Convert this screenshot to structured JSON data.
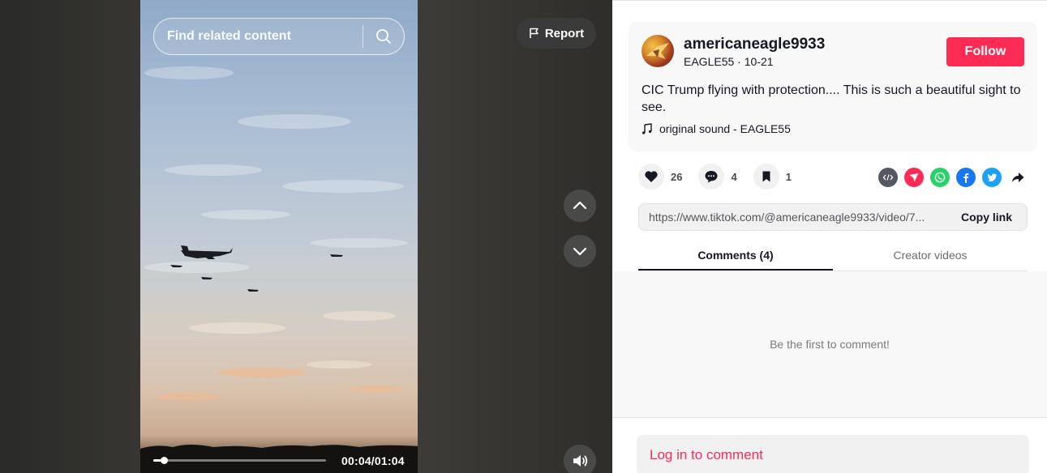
{
  "video": {
    "search_placeholder": "Find related content",
    "report_label": "Report",
    "current_time": "00:04",
    "duration": "01:04",
    "time_display": "00:04/01:04",
    "progress_fraction": 0.0625
  },
  "post": {
    "username": "americaneagle9933",
    "subline": "EAGLE55 · 10-21",
    "follow_label": "Follow",
    "caption": "CIC Trump flying with protection.... This is such a beautiful sight to see.",
    "sound": "original sound - EAGLE55"
  },
  "actions": {
    "likes": "26",
    "comments": "4",
    "saves": "1"
  },
  "share": {
    "link": "https://www.tiktok.com/@americaneagle9933/video/7...",
    "copy_label": "Copy link"
  },
  "tabs": [
    {
      "label": "Comments (4)"
    },
    {
      "label": "Creator videos"
    }
  ],
  "comments": {
    "empty_message": "Be the first to comment!",
    "login_prompt": "Log in to comment"
  },
  "colors": {
    "brand": "#fe2c55",
    "whatsapp": "#25d366",
    "facebook": "#1877f2",
    "twitter": "#1da1f2",
    "embed": "#555860"
  }
}
